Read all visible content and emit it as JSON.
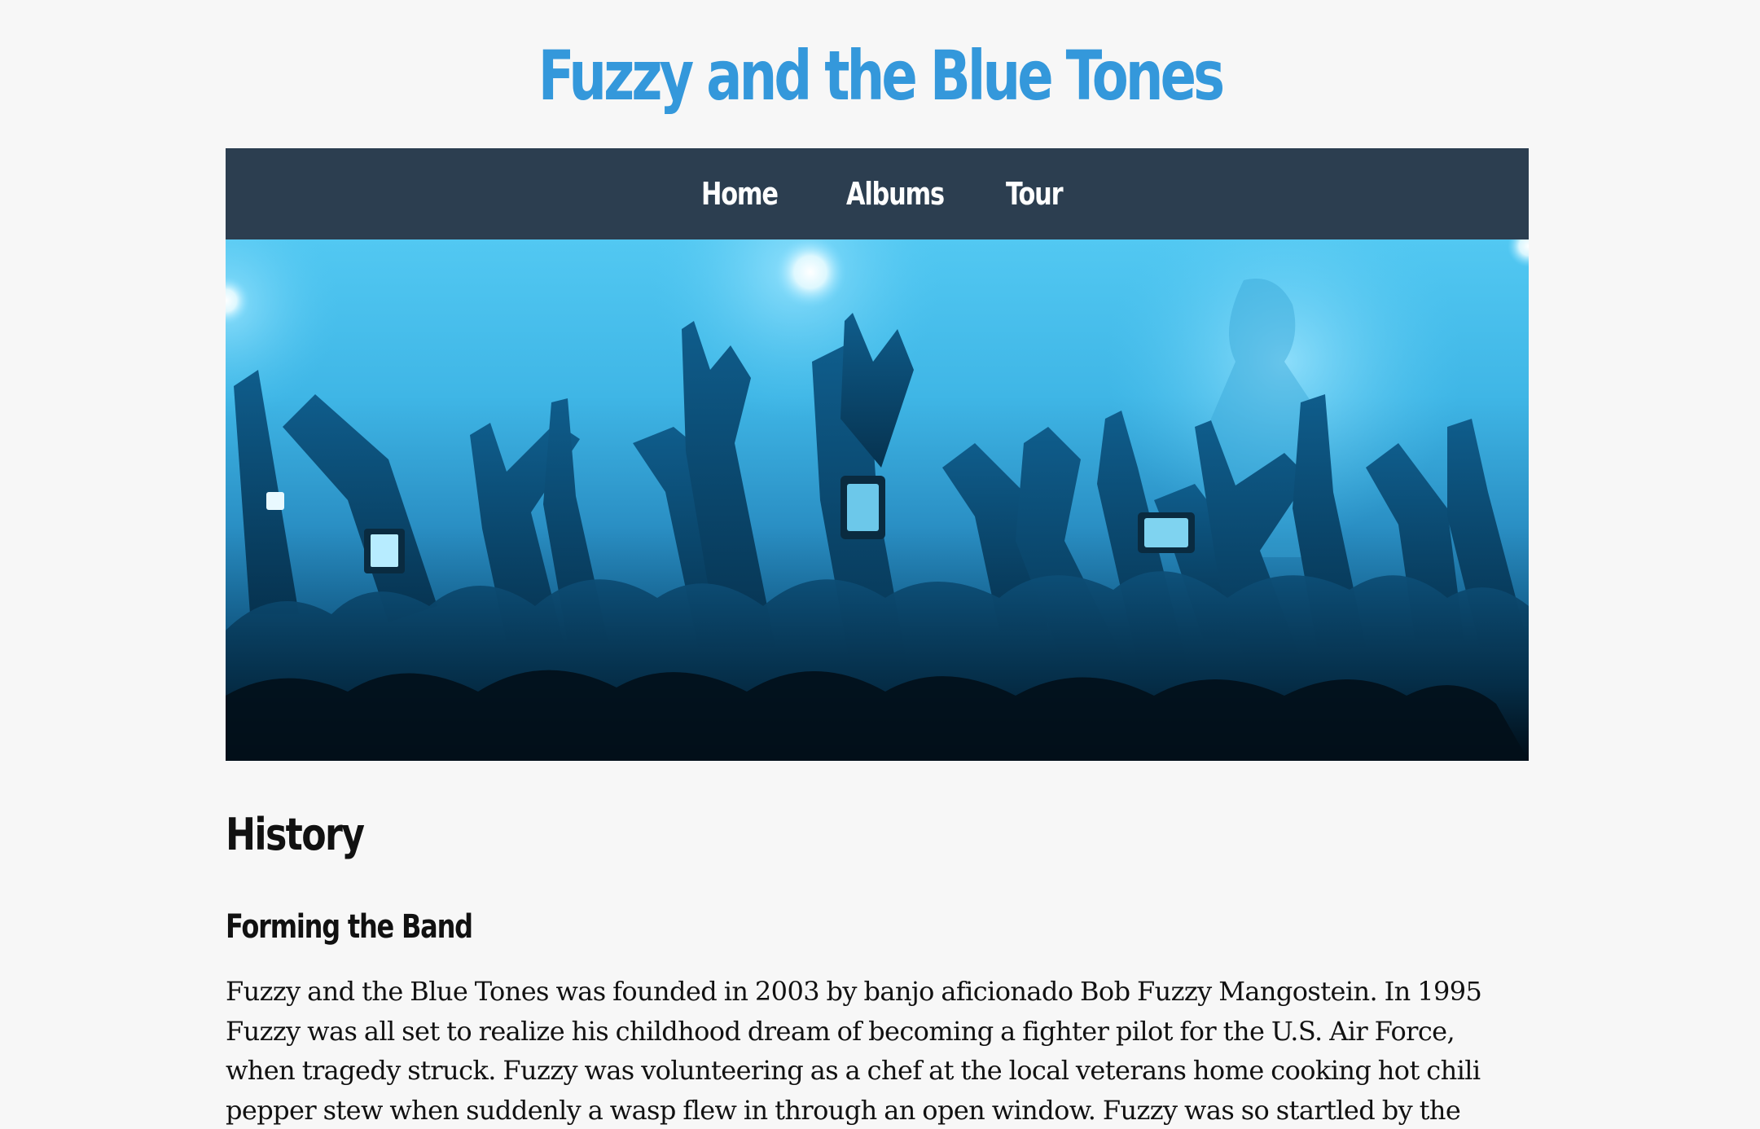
{
  "header": {
    "site_title": "Fuzzy and the Blue Tones"
  },
  "nav": {
    "items": [
      {
        "label": "Home"
      },
      {
        "label": "Albums"
      },
      {
        "label": "Tour"
      }
    ]
  },
  "hero": {
    "image": "concert-crowd-image",
    "tint_color": "#3fb6e6"
  },
  "main": {
    "heading": "History",
    "subheading": "Forming the Band",
    "paragraph": "Fuzzy and the Blue Tones was founded in 2003 by banjo aficionado Bob Fuzzy Mangostein. In 1995 Fuzzy was all set to realize his childhood dream of becoming a fighter pilot for the U.S. Air Force, when tragedy struck. Fuzzy was volunteering as a chef at the local veterans home cooking hot chili pepper stew when suddenly a wasp flew in through an open window. Fuzzy was so startled by the wasp that he knocked the"
  },
  "colors": {
    "title_blue": "#3498db",
    "nav_background": "#2c3e50",
    "page_background": "#f7f7f7",
    "text": "#111111"
  }
}
